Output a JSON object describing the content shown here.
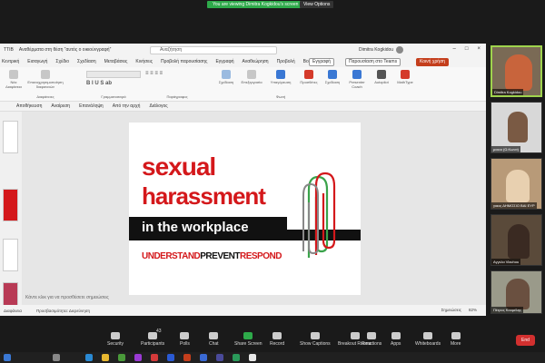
{
  "zoom": {
    "share_notice": "You are viewing Dimitra Kogkidou's screen",
    "view_options": "View Options",
    "toolbar": {
      "security": "Security",
      "participants": "Participants",
      "participants_count": "43",
      "polls": "Polls",
      "chat": "Chat",
      "share_screen": "Share Screen",
      "record": "Record",
      "show_captions": "Show Captions",
      "breakout_rooms": "Breakout Rooms",
      "reactions": "Reactions",
      "apps": "Apps",
      "whiteboards": "Whiteboards",
      "more": "More",
      "end": "End"
    },
    "participants_tiles": [
      {
        "name": "Dimitra Kogkidou"
      },
      {
        "name": "μαιου (Ω.Κωνσ)"
      },
      {
        "name": "γιαος ΔΗΜΟΣΙΟ ΒΑΙ ΕΥΡ"
      },
      {
        "name": "Αγγελα Vlachou"
      },
      {
        "name": "Πέτρος Κουμέλης"
      }
    ]
  },
  "ppt": {
    "title": "Αναθέρματα στη θέση “αυτός ο οικιούνγραφή” ",
    "file_label": "ΤΤΙΒ",
    "search_placeholder": "Αναζήτηση",
    "user_name": "Dimitra Kogkidou",
    "menu": [
      "Κεντρική",
      "Εισαγωγή",
      "Σχέδιο",
      "Σχεδίαση",
      "Μεταβάσεις",
      "Κινήσεις",
      "Προβολή παρουσίασης",
      "Εγγραφή",
      "Αναθεώρηση",
      "Προβολή",
      "Βοήθεια"
    ],
    "record_btn": "Εγγραφή",
    "present_btn": "Παρουσίαση στο Teams",
    "share_btn": "Κοινή χρήση",
    "ribbon_groups": [
      "Νέα Διαφάνεια",
      "Επαναχρησιμοποίηση διαφανειών",
      "Διαφάνειες",
      "Γραμματοσειρά",
      "Παράγραφος",
      "Σχεδίαση",
      "Επεξεργασία",
      "Υπαγόρευση",
      "Φωνή",
      "Προσθέτες",
      "Σχεδίαση",
      "Presenter Coach",
      "Autopilot",
      "MathType"
    ],
    "quick_bar": [
      "Αποθήκευση",
      "Αναίρεση",
      "Επανάληψη",
      "Από την αρχή",
      "Διάλογος"
    ],
    "notes_placeholder": "Κάντε κλικ για να προσθέσετε σημειώσεις",
    "status": {
      "slide": "Διαφάνεια",
      "accessibility": "Προσβασιμότητα: Διερεύνηση",
      "notes": "Σημειώσεις",
      "zoom": "82%"
    }
  },
  "slide": {
    "line1": "sexual",
    "line2": "harassment",
    "line3": "in the workplace",
    "tag_understand": "UNDERSTAND",
    "tag_prevent": "PREVENT",
    "tag_respond": "RESPOND"
  },
  "colors": {
    "accent_red": "#d4181b",
    "zoom_green": "#2eaa4a",
    "share_orange": "#c43e1c"
  }
}
